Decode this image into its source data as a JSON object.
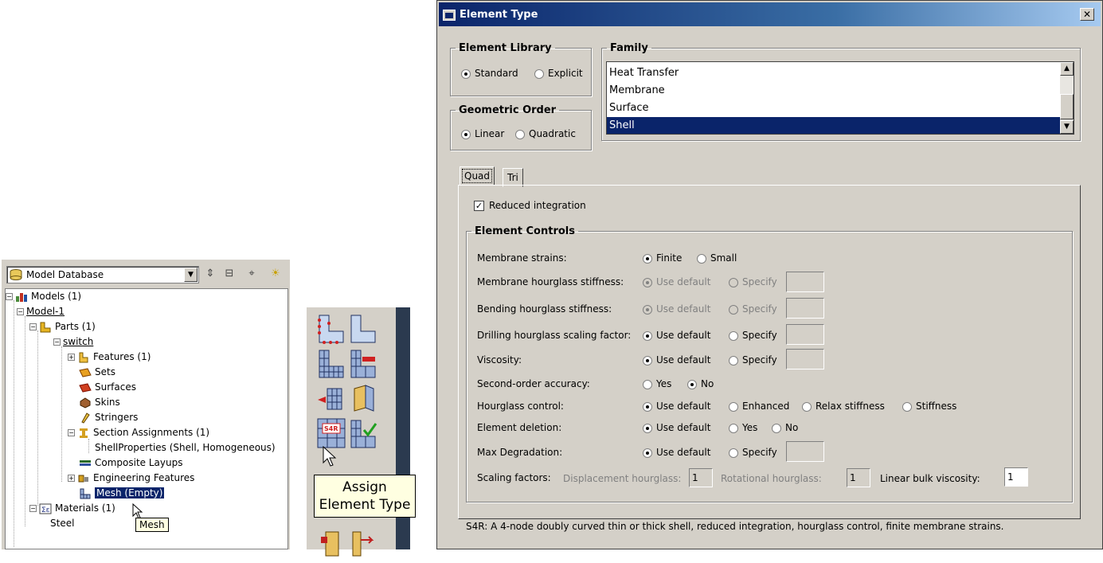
{
  "tree": {
    "dropdown_value": "Model Database",
    "items": [
      {
        "label": "Models (1)"
      },
      {
        "label": "Model-1"
      },
      {
        "label": "Parts (1)"
      },
      {
        "label": "switch"
      },
      {
        "label": "Features (1)"
      },
      {
        "label": "Sets"
      },
      {
        "label": "Surfaces"
      },
      {
        "label": "Skins"
      },
      {
        "label": "Stringers"
      },
      {
        "label": "Section Assignments (1)"
      },
      {
        "label": "ShellProperties (Shell, Homogeneous)"
      },
      {
        "label": "Composite Layups"
      },
      {
        "label": "Engineering Features"
      },
      {
        "label": "Mesh (Empty)"
      },
      {
        "label": "Materials (1)"
      },
      {
        "label": "Steel"
      }
    ],
    "tooltip": "Mesh"
  },
  "toolbox": {
    "tooltip_line1": "Assign",
    "tooltip_line2": "Element Type",
    "s4r_label": "S4R"
  },
  "dialog": {
    "title": "Element Type",
    "element_library": {
      "legend": "Element Library",
      "standard": "Standard",
      "explicit": "Explicit",
      "selected": "Standard"
    },
    "geometric_order": {
      "legend": "Geometric Order",
      "linear": "Linear",
      "quadratic": "Quadratic",
      "selected": "Linear"
    },
    "family": {
      "legend": "Family",
      "items": [
        "Heat Transfer",
        "Membrane",
        "Surface",
        "Shell"
      ],
      "selected": "Shell"
    },
    "tabs": [
      "Quad",
      "Tri"
    ],
    "reduced_integration": "Reduced integration",
    "element_controls_legend": "Element Controls",
    "controls": {
      "membrane_strains": {
        "label": "Membrane strains:",
        "opt1": "Finite",
        "opt2": "Small"
      },
      "membrane_hourglass": {
        "label": "Membrane hourglass stiffness:",
        "opt1": "Use default",
        "opt2": "Specify"
      },
      "bending_hourglass": {
        "label": "Bending hourglass stiffness:",
        "opt1": "Use default",
        "opt2": "Specify"
      },
      "drilling_hourglass": {
        "label": "Drilling hourglass scaling factor:",
        "opt1": "Use default",
        "opt2": "Specify"
      },
      "viscosity": {
        "label": "Viscosity:",
        "opt1": "Use default",
        "opt2": "Specify"
      },
      "second_order": {
        "label": "Second-order accuracy:",
        "opt1": "Yes",
        "opt2": "No"
      },
      "hourglass_control": {
        "label": "Hourglass control:",
        "opt1": "Use default",
        "opt2": "Enhanced",
        "opt3": "Relax stiffness",
        "opt4": "Stiffness"
      },
      "element_deletion": {
        "label": "Element deletion:",
        "opt1": "Use default",
        "opt2": "Yes",
        "opt3": "No"
      },
      "max_degradation": {
        "label": "Max Degradation:",
        "opt1": "Use default",
        "opt2": "Specify"
      },
      "scaling": {
        "label": "Scaling factors:",
        "disp_label": "Displacement hourglass:",
        "disp_value": "1",
        "rot_label": "Rotational hourglass:",
        "rot_value": "1",
        "bulk_label": "Linear bulk viscosity:",
        "bulk_value": "1"
      }
    },
    "description": "S4R:  A 4-node doubly curved thin or thick shell, reduced integration, hourglass control, finite membrane strains."
  }
}
